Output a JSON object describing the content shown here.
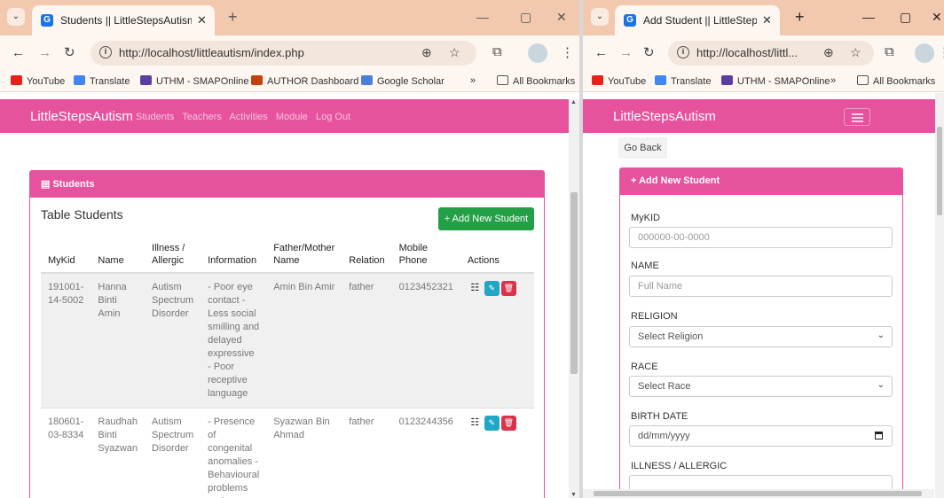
{
  "left": {
    "tab_title": "Students || LittleStepsAutism",
    "url": "http://localhost/littleautism/index.php",
    "bookmarks": [
      "YouTube",
      "Translate",
      "UTHM - SMAPOnline",
      "AUTHOR Dashboard",
      "Google Scholar",
      "All Bookmarks"
    ],
    "more": "»",
    "brand": "LittleStepsAutism",
    "nav": [
      "Students",
      "Teachers",
      "Activities",
      "Module",
      "Log Out"
    ],
    "card_title": "Students",
    "table_title": "Table Students",
    "add_button": "+ Add New Student",
    "columns": [
      "MyKid",
      "Name",
      "Illness / Allergic",
      "Information",
      "Father/Mother Name",
      "Relation",
      "Mobile Phone",
      "Actions"
    ],
    "rows": [
      {
        "mykid": "191001-14-5002",
        "name": "Hanna Binti Amin",
        "illness": "Autism Spectrum Disorder",
        "info": "- Poor eye contact - Less social smilling and delayed expressive - Poor receptive language",
        "parent": "Amin Bin Amir",
        "relation": "father",
        "phone": "0123452321"
      },
      {
        "mykid": "180601-03-8334",
        "name": "Raudhah Binti Syazwan",
        "illness": "Autism Spectrum Disorder",
        "info": "- Presence of congenital anomalies - Behavioural problems and",
        "parent": "Syazwan Bin Ahmad",
        "relation": "father",
        "phone": "0123244356"
      }
    ]
  },
  "right": {
    "tab_title": "Add Student || LittleStepsAutism",
    "url": "http://localhost/littl...",
    "bookmarks": [
      "YouTube",
      "Translate",
      "UTHM - SMAPOnline",
      "All Bookmarks"
    ],
    "more": "»",
    "brand": "LittleStepsAutism",
    "go_back": "Go Back",
    "card_title": "+ Add New Student",
    "fields": {
      "mykid_label": "MyKID",
      "mykid_placeholder": "000000-00-0000",
      "name_label": "NAME",
      "name_placeholder": "Full Name",
      "religion_label": "RELIGION",
      "religion_value": "Select Religion",
      "race_label": "RACE",
      "race_value": "Select Race",
      "birth_label": "BIRTH DATE",
      "birth_placeholder": "dd/mm/yyyy",
      "illness_label": "ILLNESS / ALLERGIC"
    }
  },
  "colors": {
    "brand_pink": "#e6529e",
    "add_green": "#23a046",
    "edit_blue": "#21a7c6",
    "delete_red": "#d9334a",
    "tab_bar": "#f2c9ae"
  }
}
